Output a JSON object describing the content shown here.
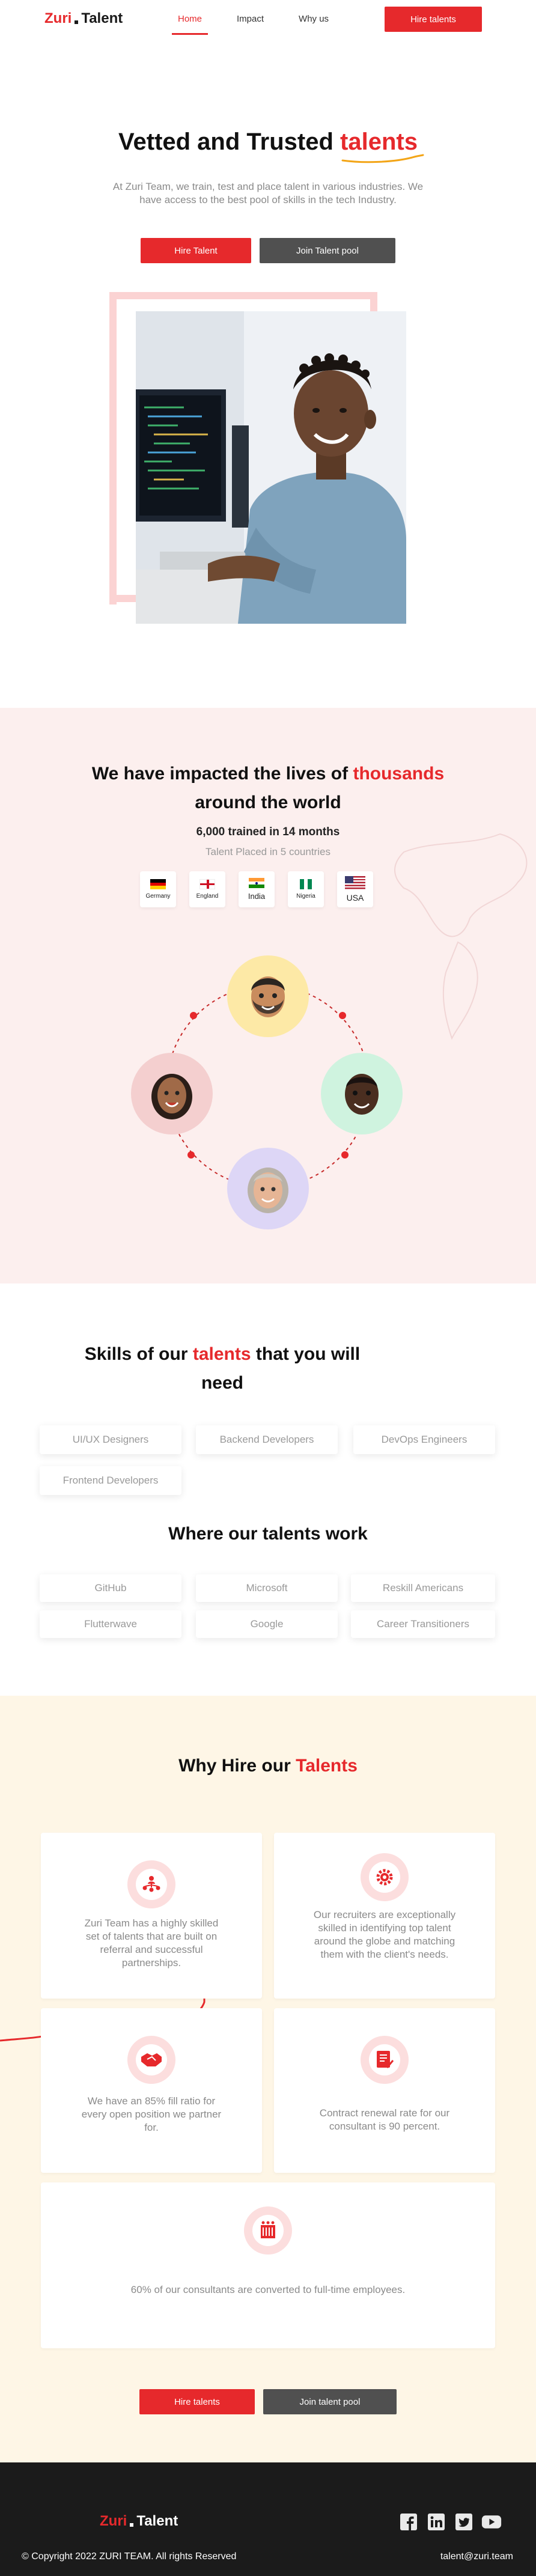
{
  "nav": {
    "logo_part1": "Zuri",
    "logo_part2": "Talent",
    "links": [
      "Home",
      "Impact",
      "Why us"
    ],
    "cta": "Hire talents"
  },
  "hero": {
    "title_prefix": "Vetted and Trusted",
    "title_highlight": "talents",
    "subtitle": "At Zuri Team, we train, test and place talent in various industries. We have access to the best pool of skills in the tech Industry.",
    "btn_primary": "Hire Talent",
    "btn_secondary": "Join Talent pool"
  },
  "impact": {
    "title_prefix": "We have impacted the lives of",
    "title_highlight": "thousands",
    "title_suffix": "around the world",
    "stat": "6,000 trained in 14 months",
    "countries_text": "Talent Placed in 5 countries",
    "flags": [
      {
        "name": "Germany",
        "icon": "germany-flag"
      },
      {
        "name": "England",
        "icon": "england-flag"
      },
      {
        "name": "India",
        "icon": "india-flag"
      },
      {
        "name": "Nigeria",
        "icon": "nigeria-flag"
      },
      {
        "name": "USA",
        "icon": "usa-flag"
      }
    ]
  },
  "skills": {
    "title_prefix": "Skills of our",
    "title_highlight": "talents",
    "title_suffix": "that you will need",
    "items": [
      "UI/UX Designers",
      "Backend Developers",
      "DevOps Engineers",
      "Frontend Developers"
    ]
  },
  "work": {
    "title": "Where our talents work",
    "items": [
      "GitHub",
      "Microsoft",
      "Reskill Americans",
      "Flutterwave",
      "Google",
      "Career Transitioners"
    ]
  },
  "why": {
    "title_prefix": "Why Hire our",
    "title_highlight": "Talents",
    "cards": [
      {
        "text": "Zuri Team has a highly skilled set of talents that are built on referral and successful partnerships.",
        "icon": "team-network-icon"
      },
      {
        "text": "Our recruiters are exceptionally skilled in identifying top talent around the globe and matching them with the client's needs.",
        "icon": "gear-settings-icon"
      },
      {
        "text": "We have an 85% fill ratio for every open position we partner for.",
        "icon": "handshake-icon"
      },
      {
        "text": "Contract renewal rate for our consultant is 90 percent.",
        "icon": "contract-document-icon"
      },
      {
        "text": "60% of our consultants are converted to full-time employees.",
        "icon": "employees-icon"
      }
    ],
    "btn_primary": "Hire talents",
    "btn_secondary": "Join talent pool"
  },
  "footer": {
    "logo_part1": "Zuri",
    "logo_part2": "Talent",
    "copyright": "© Copyright 2022 ZURI TEAM. All rights Reserved",
    "email": "talent@zuri.team",
    "socials": [
      "facebook-icon",
      "linkedin-icon",
      "twitter-icon",
      "youtube-icon"
    ]
  },
  "colors": {
    "accent": "#e6292c",
    "dark_button": "#505050",
    "impact_bg": "#fcefee",
    "why_bg": "#fef6e6",
    "footer_bg": "#1b1b1b"
  }
}
